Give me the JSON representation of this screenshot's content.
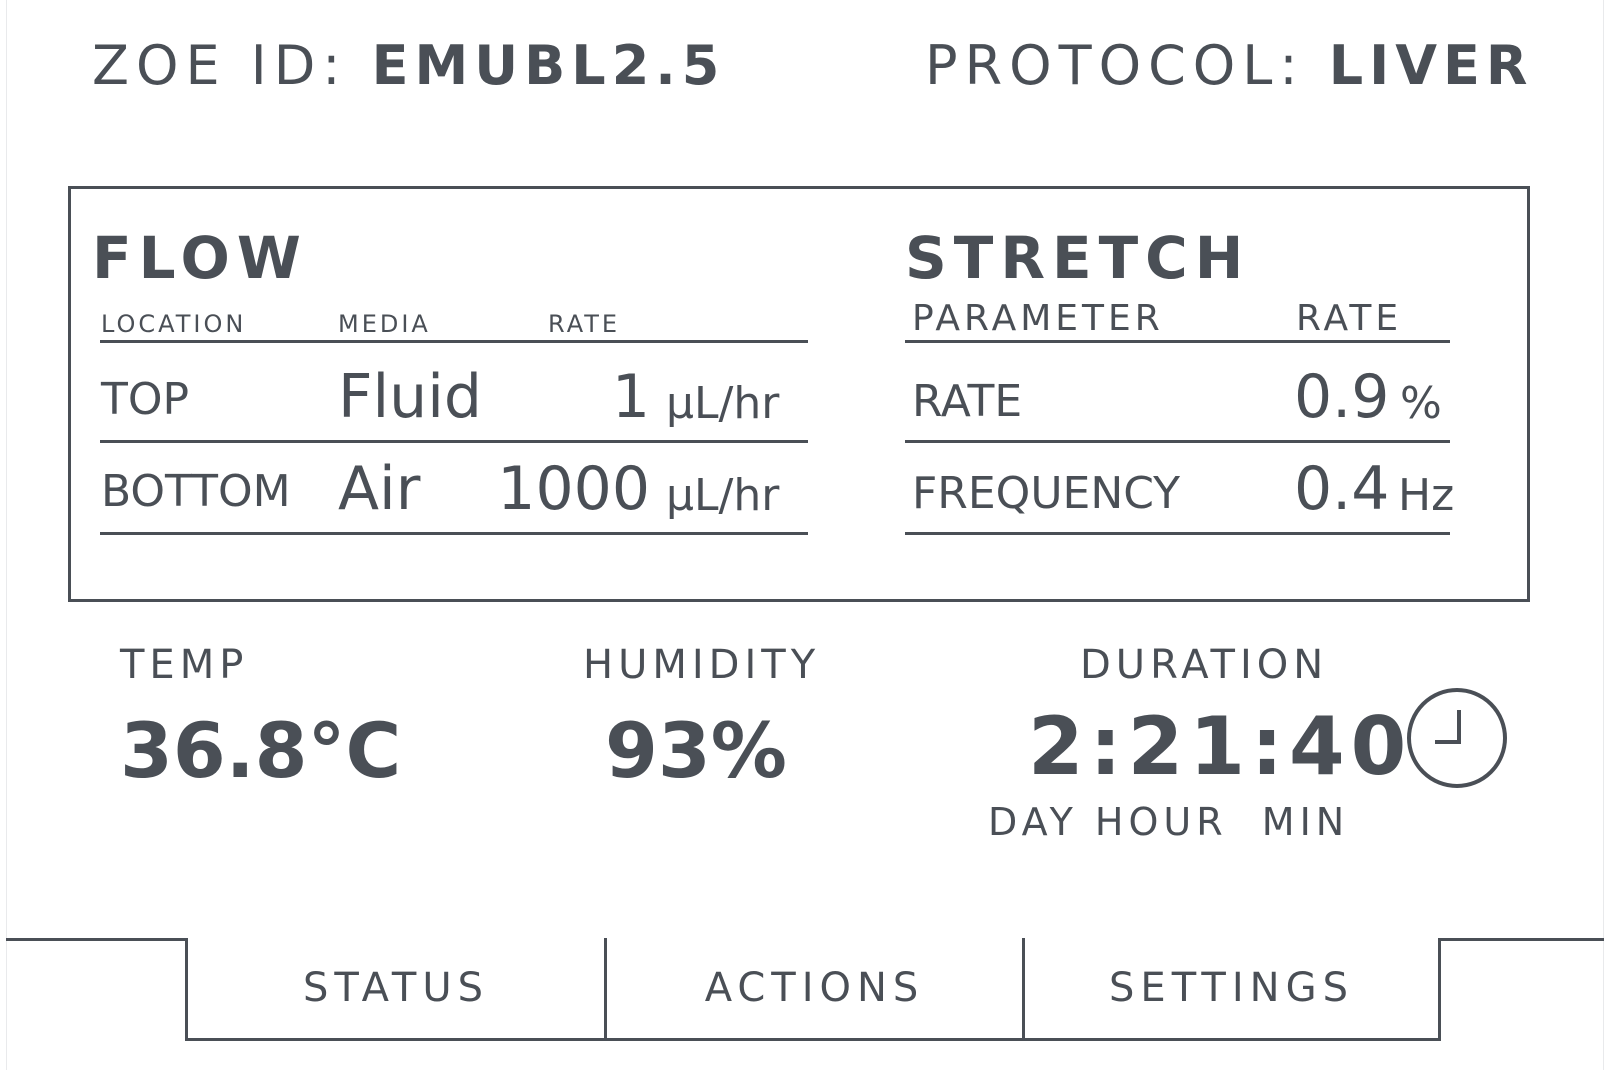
{
  "header": {
    "zoe_label": "ZOE ID:",
    "zoe_value": "EMUBL2.5",
    "protocol_label": "PROTOCOL:",
    "protocol_value": "LIVER"
  },
  "flow": {
    "title": "FLOW",
    "col_location": "LOCATION",
    "col_media": "MEDIA",
    "col_rate": "RATE",
    "rows": [
      {
        "location": "TOP",
        "media": "Fluid",
        "rate": "1",
        "unit": "µL/hr"
      },
      {
        "location": "BOTTOM",
        "media": "Air",
        "rate": "1000",
        "unit": "µL/hr"
      }
    ]
  },
  "stretch": {
    "title": "STRETCH",
    "col_parameter": "PARAMETER",
    "col_rate": "RATE",
    "rows": [
      {
        "parameter": "RATE",
        "value": "0.9",
        "unit": "%"
      },
      {
        "parameter": "FREQUENCY",
        "value": "0.4",
        "unit": "Hz"
      }
    ]
  },
  "readings": {
    "temp_label": "TEMP",
    "temp_value": "36.8°C",
    "humidity_label": "HUMIDITY",
    "humidity_value": "93%",
    "duration_label": "DURATION",
    "duration_value": "2:21:40",
    "duration_units": "DAY HOUR  MIN",
    "duration_icon": "clock-icon"
  },
  "tabs": [
    {
      "label": "STATUS"
    },
    {
      "label": "ACTIONS"
    },
    {
      "label": "SETTINGS"
    }
  ],
  "colors": {
    "foreground": "#4a4f56",
    "background": "#ffffff"
  }
}
